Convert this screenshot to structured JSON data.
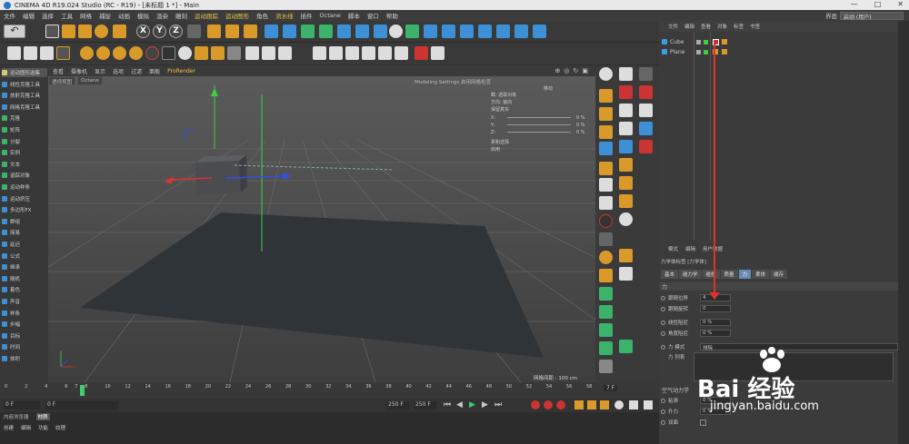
{
  "titlebar": {
    "title": "CINEMA 4D R19.024 Studio (RC - R19) - [未标题 1 *] - Main",
    "min": "—",
    "max": "□",
    "close": "✕"
  },
  "menu": {
    "items": [
      "文件",
      "编辑",
      "选择",
      "工具",
      "网格",
      "捕捉",
      "动画",
      "模拟",
      "渲染",
      "雕刻",
      "运动跟踪",
      "运动图形",
      "角色",
      "流水线",
      "插件",
      "Octane",
      "脚本",
      "窗口",
      "帮助"
    ],
    "layout_label": "界面",
    "layout_value": "启动 (用户)"
  },
  "left_tools": [
    "运动图形选集",
    "线性克隆工具",
    "放射克隆工具",
    "网格克隆工具",
    "克隆",
    "矩阵",
    "分裂",
    "实例",
    "文本",
    "追踪对象",
    "运动样条",
    "运动挤压",
    "多边形FX",
    "群组",
    "简易",
    "延迟",
    "公式",
    "继承",
    "随机",
    "着色",
    "声音",
    "样条",
    "步幅",
    "目标",
    "时间",
    "体积"
  ],
  "viewport": {
    "menu": [
      "查看",
      "摄像机",
      "显示",
      "选项",
      "过滤",
      "面板",
      "ProRender"
    ],
    "tabs": [
      "透视视图",
      "Octane"
    ],
    "settings_title": "Modeling Settings 启用网格检查",
    "material_panel": {
      "mode": "移动",
      "lines": [
        "截: 选取对象",
        "方向: 轴向",
        "保留真实",
        "X:",
        "Y:",
        "Z:",
        "柔和选择",
        "启用"
      ],
      "pct": [
        "0 %",
        "0 %",
        "0 %"
      ]
    },
    "grid_spacing": "网格间距 : 100 cm"
  },
  "timeline": {
    "ticks": [
      "0",
      "2",
      "4",
      "6",
      "7",
      "8",
      "10",
      "12",
      "14",
      "16",
      "18",
      "20",
      "22",
      "24",
      "26",
      "28",
      "30",
      "32",
      "34",
      "36",
      "38",
      "40",
      "42",
      "44",
      "46",
      "48",
      "50",
      "52",
      "54",
      "56",
      "58"
    ],
    "end": "7 F"
  },
  "playbar": {
    "start": "0 F",
    "f0": "0 F",
    "f1": "250 F",
    "f2": "250 F"
  },
  "bottom": {
    "tabs": [
      "内容浏览器",
      "材质"
    ],
    "menu": [
      "创建",
      "编辑",
      "功能",
      "纹理"
    ]
  },
  "objects": {
    "tabs": [
      "文件",
      "编辑",
      "查看",
      "对象",
      "标签",
      "书签"
    ],
    "rows": [
      {
        "name": "Cube"
      },
      {
        "name": "Plane"
      }
    ]
  },
  "attributes": {
    "header": [
      "模式",
      "编辑",
      "用户数据"
    ],
    "title": "力学体标签 [力学体]",
    "tabs": [
      "基本",
      "碰力学",
      "碰撞",
      "质量",
      "力",
      "柔体",
      "缓存"
    ],
    "active_tab": "力",
    "section": "力",
    "rows": [
      {
        "label": "跟随位移",
        "value": "4"
      },
      {
        "label": "跟随旋转",
        "value": "0"
      },
      {
        "label": "线性阻尼",
        "value": "0 %"
      },
      {
        "label": "角度阻尼",
        "value": "0 %"
      }
    ],
    "force_mode_label": "力 模式",
    "force_mode_value": "排除",
    "force_list_label": "力 列表",
    "air_section": "空气动力学",
    "air_rows": [
      {
        "label": "粘滞",
        "value": "0 %"
      },
      {
        "label": "升力",
        "value": "0 %"
      },
      {
        "label": "双面",
        "value": ""
      }
    ]
  },
  "watermark": {
    "brand": "Bai 经验",
    "url": "jingyan.baidu.com"
  }
}
